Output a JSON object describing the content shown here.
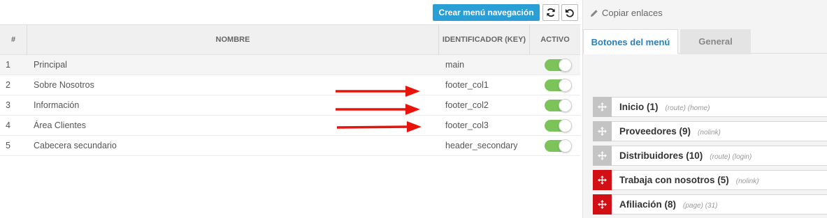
{
  "toolbar": {
    "create_label": "Crear menú navegación",
    "refresh_icon": "refresh-icon",
    "undo_icon": "undo-icon",
    "accent_color": "#2a9fd6"
  },
  "table": {
    "headers": {
      "num": "#",
      "name": "NOMBRE",
      "key": "IDENTIFICADOR (KEY)",
      "active": "ACTIVO"
    },
    "rows": [
      {
        "num": "1",
        "name": "Principal",
        "key": "main",
        "active": true
      },
      {
        "num": "2",
        "name": "Sobre Nosotros",
        "key": "footer_col1",
        "active": true
      },
      {
        "num": "3",
        "name": "Información",
        "key": "footer_col2",
        "active": true
      },
      {
        "num": "4",
        "name": "Área Clientes",
        "key": "footer_col3",
        "active": true
      },
      {
        "num": "5",
        "name": "Cabecera secundario",
        "key": "header_secondary",
        "active": true
      }
    ],
    "toggle_on_color": "#7cc35a"
  },
  "annotations": {
    "arrow_color": "#e8140c",
    "arrow_rows": [
      2,
      3,
      4
    ]
  },
  "right_panel": {
    "copy_links_label": "Copiar enlaces",
    "tabs": [
      {
        "label": "Botones del menú",
        "active": true
      },
      {
        "label": "General",
        "active": false
      }
    ],
    "menu_items": [
      {
        "label": "Inicio (1)",
        "meta": "(route) (home)",
        "handle_color": "gray"
      },
      {
        "label": "Proveedores (9)",
        "meta": "(nolink)",
        "handle_color": "gray"
      },
      {
        "label": "Distribuidores (10)",
        "meta": "(route) (login)",
        "handle_color": "gray"
      },
      {
        "label": "Trabaja con nosotros (5)",
        "meta": "(nolink)",
        "handle_color": "red"
      },
      {
        "label": "Afiliación (8)",
        "meta": "(page) (31)",
        "handle_color": "red"
      }
    ]
  }
}
